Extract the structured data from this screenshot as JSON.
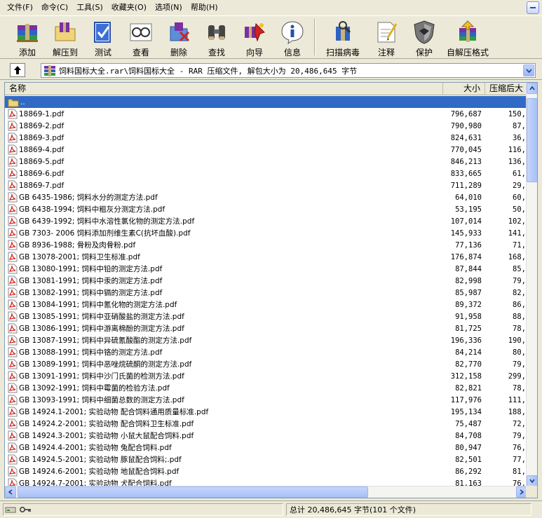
{
  "menu": [
    "文件(F)",
    "命令(C)",
    "工具(S)",
    "收藏夹(O)",
    "选项(N)",
    "帮助(H)"
  ],
  "toolbar": [
    {
      "label": "添加",
      "icon": "add-books-icon"
    },
    {
      "label": "解压到",
      "icon": "extract-folder-icon"
    },
    {
      "label": "测试",
      "icon": "test-check-icon"
    },
    {
      "label": "查看",
      "icon": "view-glasses-icon"
    },
    {
      "label": "删除",
      "icon": "delete-icon"
    },
    {
      "label": "查找",
      "icon": "find-binoculars-icon"
    },
    {
      "label": "向导",
      "icon": "wizard-icon"
    },
    {
      "label": "信息",
      "icon": "info-icon"
    },
    {
      "label": "扫描病毒",
      "icon": "virus-scan-icon"
    },
    {
      "label": "注释",
      "icon": "comment-icon"
    },
    {
      "label": "保护",
      "icon": "protect-shield-icon"
    },
    {
      "label": "自解压格式",
      "icon": "sfx-icon"
    }
  ],
  "address": {
    "path": "饲料国标大全.rar\\饲料国标大全 - RAR 压缩文件, 解包大小为 20,486,645 字节"
  },
  "columns": {
    "name": "名称",
    "size": "大小",
    "packed": "压缩后大"
  },
  "parent_row": "..",
  "files": [
    {
      "name": "18869-1.pdf",
      "size": "796,687",
      "packed": "150,"
    },
    {
      "name": "18869-2.pdf",
      "size": "790,980",
      "packed": "87,"
    },
    {
      "name": "18869-3.pdf",
      "size": "824,631",
      "packed": "36,"
    },
    {
      "name": "18869-4.pdf",
      "size": "770,045",
      "packed": "116,"
    },
    {
      "name": "18869-5.pdf",
      "size": "846,213",
      "packed": "136,"
    },
    {
      "name": "18869-6.pdf",
      "size": "833,665",
      "packed": "61,"
    },
    {
      "name": "18869-7.pdf",
      "size": "711,289",
      "packed": "29,"
    },
    {
      "name": "GB 6435-1986; 饲料水分的测定方法.pdf",
      "size": "64,010",
      "packed": "60,"
    },
    {
      "name": "GB 6438-1994; 饲料中粗灰分测定方法.pdf",
      "size": "53,195",
      "packed": "50,"
    },
    {
      "name": "GB 6439-1992; 饲料中水溶性氯化物的测定方法.pdf",
      "size": "107,014",
      "packed": "102,"
    },
    {
      "name": "GB 7303- 2006 饲料添加剂维生素C(抗坏血酸).pdf",
      "size": "145,933",
      "packed": "141,"
    },
    {
      "name": "GB 8936-1988; 骨粉及肉骨粉.pdf",
      "size": "77,136",
      "packed": "71,"
    },
    {
      "name": "GB 13078-2001; 饲料卫生标准.pdf",
      "size": "176,874",
      "packed": "168,"
    },
    {
      "name": "GB 13080-1991; 饲料中铅的测定方法.pdf",
      "size": "87,844",
      "packed": "85,"
    },
    {
      "name": "GB 13081-1991; 饲料中汞的测定方法.pdf",
      "size": "82,998",
      "packed": "79,"
    },
    {
      "name": "GB 13082-1991; 饲料中镉的测定方法.pdf",
      "size": "85,987",
      "packed": "82,"
    },
    {
      "name": "GB 13084-1991; 饲料中氰化物的测定方法.pdf",
      "size": "89,372",
      "packed": "86,"
    },
    {
      "name": "GB 13085-1991; 饲料中亚硝酸盐的测定方法.pdf",
      "size": "91,958",
      "packed": "88,"
    },
    {
      "name": "GB 13086-1991; 饲料中游离棉酚的测定方法.pdf",
      "size": "81,725",
      "packed": "78,"
    },
    {
      "name": "GB 13087-1991; 饲料中异硫氰酸酯的测定方法.pdf",
      "size": "196,336",
      "packed": "190,"
    },
    {
      "name": "GB 13088-1991; 饲料中铬的测定方法.pdf",
      "size": "84,214",
      "packed": "80,"
    },
    {
      "name": "GB 13089-1991; 饲料中恶唑烷硫酮的测定方法.pdf",
      "size": "82,770",
      "packed": "79,"
    },
    {
      "name": "GB 13091-1991; 饲料中沙门氏菌的检测方法.pdf",
      "size": "312,158",
      "packed": "299,"
    },
    {
      "name": "GB 13092-1991; 饲料中霉菌的检验方法.pdf",
      "size": "82,821",
      "packed": "78,"
    },
    {
      "name": "GB 13093-1991; 饲料中细菌总数的测定方法.pdf",
      "size": "117,976",
      "packed": "111,"
    },
    {
      "name": "GB 14924.1-2001; 实验动物 配合饲料通用质量标准.pdf",
      "size": "195,134",
      "packed": "188,"
    },
    {
      "name": "GB 14924.2-2001; 实验动物 配合饲料卫生标准.pdf",
      "size": "75,487",
      "packed": "72,"
    },
    {
      "name": "GB 14924.3-2001; 实验动物 小鼠大鼠配合饲料.pdf",
      "size": "84,708",
      "packed": "79,"
    },
    {
      "name": "GB 14924.4-2001; 实验动物 兔配合饲料.pdf",
      "size": "80,947",
      "packed": "76,"
    },
    {
      "name": "GB 14924.5-2001; 实验动物 豚鼠配合饲料;.pdf",
      "size": "82,501",
      "packed": "77,"
    },
    {
      "name": "GB 14924.6-2001; 实验动物 地鼠配合饲料.pdf",
      "size": "86,292",
      "packed": "81,"
    },
    {
      "name": "GB 14924.7-2001; 实验动物 犬配合饲料.pdf",
      "size": "81,163",
      "packed": "76,"
    }
  ],
  "status": {
    "total": "总计 20,486,645 字节(101 个文件)"
  },
  "colors": {
    "selection": "#316ac5",
    "chrome": "#ece9d8",
    "pdf_red": "#d42020"
  }
}
